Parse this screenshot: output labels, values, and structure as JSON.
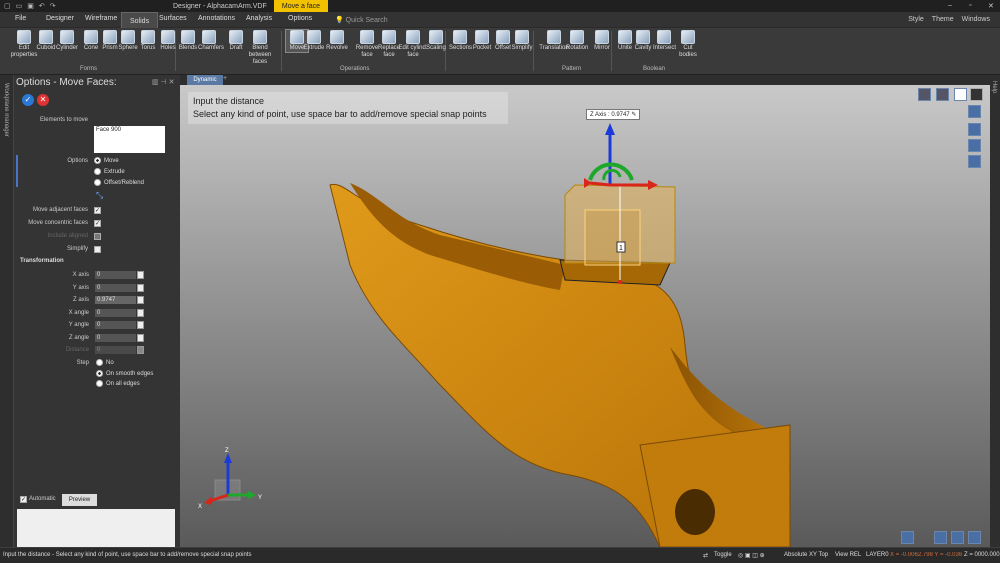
{
  "title_bar": {
    "app_title": "Designer - AlphacamArm.VDF",
    "context_tab": "Move a face"
  },
  "menu": {
    "tabs": [
      "File",
      "Designer",
      "Wireframe",
      "Solids",
      "Surfaces",
      "Annotations",
      "Analysis",
      "Options"
    ],
    "active": "Solids",
    "quick_search": "Quick Search",
    "right_menu": [
      "Style",
      "Theme",
      "Windows"
    ]
  },
  "ribbon": {
    "buttons": [
      "Edit properties",
      "Cuboid",
      "Cylinder",
      "Cone",
      "Prism",
      "Sphere",
      "Torus",
      "Holes",
      "Blends",
      "Chamfers",
      "Draft",
      "Blend between faces",
      "Move",
      "Extrude",
      "Revolve",
      "Remove face",
      "Replace face",
      "Edit cylind. face",
      "Scaling",
      "Sections",
      "Pocket",
      "Offset",
      "Simplify",
      "Translation",
      "Rotation",
      "Mirror",
      "Unite",
      "Cavity",
      "Intersect",
      "Cut bodies"
    ],
    "groups": [
      "Forms",
      "Operations",
      "Pattern",
      "Boolean"
    ]
  },
  "doc_tab": {
    "label": "Dynamic"
  },
  "side": {
    "workplane_manager": "Workplane manager",
    "help": "Help"
  },
  "panel": {
    "title": "Options - Move Faces:",
    "elements_label": "Elements to move",
    "elements_value": "Face 900",
    "options_label": "Options",
    "options": [
      "Move",
      "Extrude",
      "Offset/Reblend"
    ],
    "option_selected": "Move",
    "checks": [
      {
        "label": "Move adjacent faces",
        "checked": true
      },
      {
        "label": "Move concentric faces",
        "checked": true
      },
      {
        "label": "Include aligned",
        "checked": false
      },
      {
        "label": "Simplify",
        "checked": false
      }
    ],
    "transformation_label": "Transformation",
    "fields": [
      {
        "label": "X axis",
        "value": "0"
      },
      {
        "label": "Y axis",
        "value": "0"
      },
      {
        "label": "Z axis",
        "value": "0.9747"
      },
      {
        "label": "X angle",
        "value": "0"
      },
      {
        "label": "Y angle",
        "value": "0"
      },
      {
        "label": "Z angle",
        "value": "0"
      },
      {
        "label": "Distance",
        "value": "0"
      }
    ],
    "step_label": "Step",
    "steps": [
      "No",
      "On smooth edges",
      "On all edges"
    ],
    "step_selected": "On smooth edges",
    "automatic_label": "Automatic",
    "automatic_checked": true,
    "preview_label": "Preview"
  },
  "viewport": {
    "prompt_line1": "Input the distance",
    "prompt_line2": "Select any kind of point, use space bar to add/remove special snap points",
    "z_axis_label": "Z Axis : 0.9747",
    "handle_marker": "1",
    "triad_z": "Z",
    "triad_y": "Y",
    "triad_x": "X",
    "model_color": "#d4870b"
  },
  "status": {
    "message": "Input the distance - Select any kind of point, use space bar to add/remove special snap points",
    "toggle": "Toggle",
    "plane": "Absolute XY Top",
    "view": "View REL",
    "layer": "LAYER0",
    "coords": "X = -0.0062.798  Y = -0.036.627",
    "zval": "Z = 0000.000"
  }
}
